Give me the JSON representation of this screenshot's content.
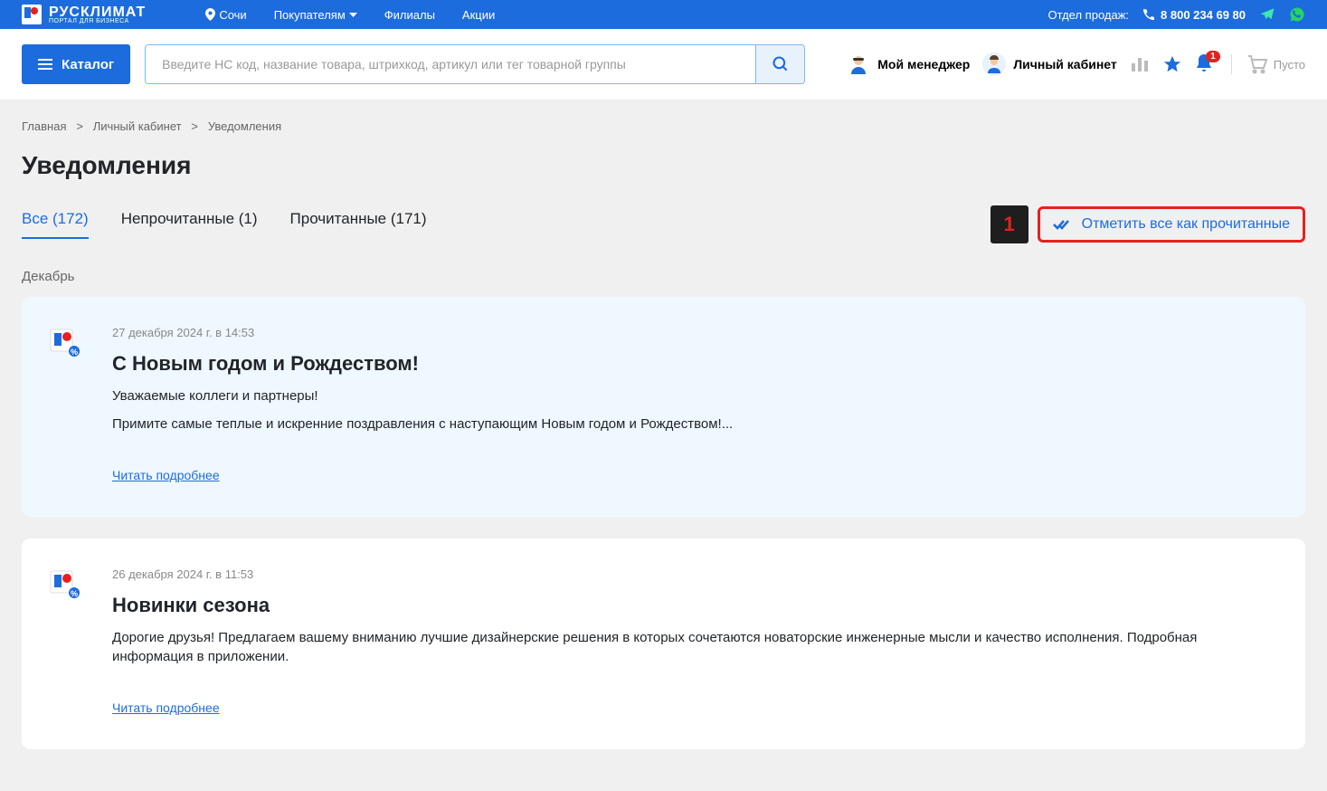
{
  "topbar": {
    "logo_main": "РУСКЛИМАТ",
    "logo_sub": "ПОРТАЛ ДЛЯ БИЗНЕСА",
    "location": "Сочи",
    "nav": {
      "buyers": "Покупателям",
      "branches": "Филиалы",
      "promo": "Акции"
    },
    "sales_dept_label": "Отдел продаж:",
    "phone": "8 800 234 69 80"
  },
  "header": {
    "catalog": "Каталог",
    "search_placeholder": "Введите НС код, название товара, штрихкод, артикул или тег товарной группы",
    "manager": "Мой менеджер",
    "account": "Личный кабинет",
    "notif_badge": "1",
    "cart": "Пусто"
  },
  "breadcrumb": {
    "home": "Главная",
    "account": "Личный кабинет",
    "current": "Уведомления",
    "sep": ">"
  },
  "page_title": "Уведомления",
  "tabs": {
    "all": "Все (172)",
    "unread": "Непрочитанные (1)",
    "read": "Прочитанные (171)"
  },
  "callout_number": "1",
  "mark_read": "Отметить все как прочитанные",
  "month": "Декабрь",
  "notifications": [
    {
      "date": "27 декабря 2024 г. в 14:53",
      "title": "С Новым годом и Рождеством!",
      "text1": "Уважаемые коллеги и партнеры!",
      "text2": "Примите самые теплые и искренние поздравления с наступающим Новым годом и Рождеством!...",
      "link": "Читать подробнее",
      "unread": true
    },
    {
      "date": "26 декабря 2024 г. в 11:53",
      "title": "Новинки сезона",
      "text1": "Дорогие друзья! Предлагаем вашему вниманию лучшие дизайнерские решения в которых сочетаются новаторские инженерные мысли и качество исполнения. Подробная информация в приложении.",
      "text2": "",
      "link": "Читать подробнее",
      "unread": false
    }
  ]
}
